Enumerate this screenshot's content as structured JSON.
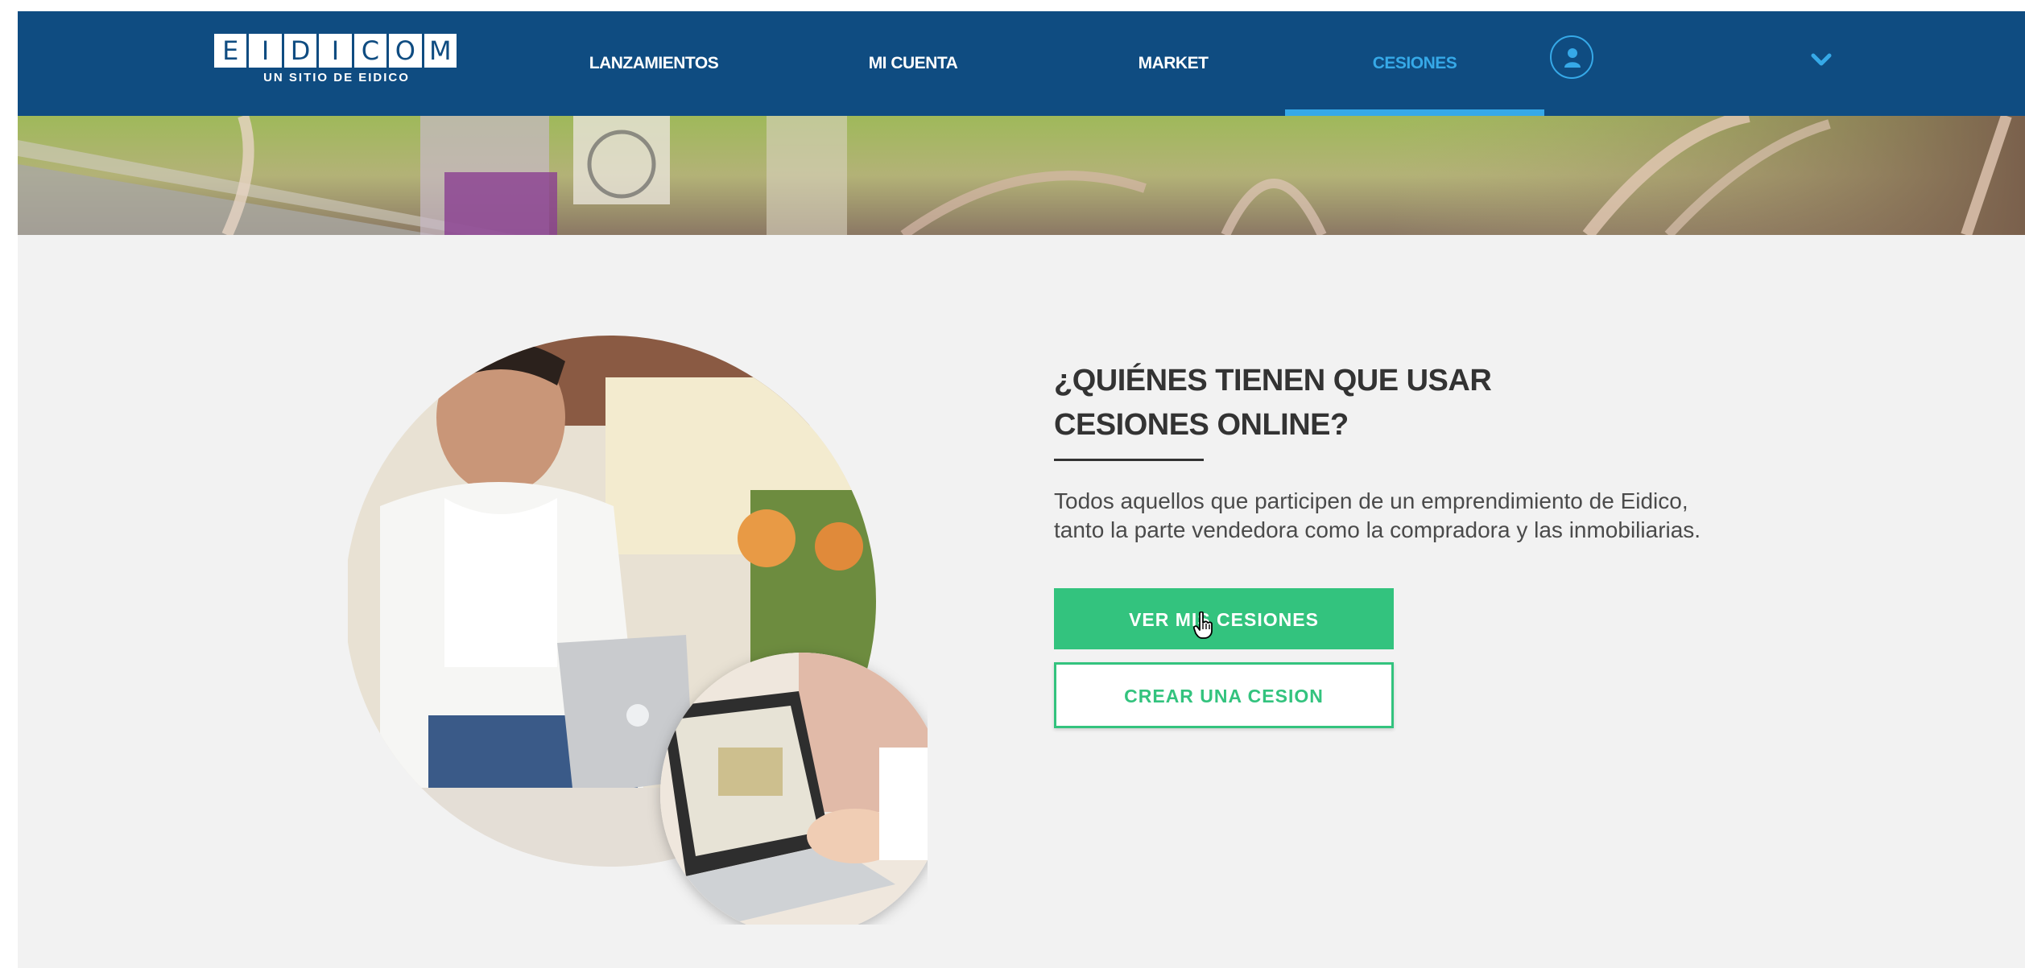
{
  "brand": {
    "logo_letters": [
      "E",
      "I",
      "D",
      "I",
      "C",
      "O",
      "M"
    ],
    "tagline": "UN SITIO DE EIDICO"
  },
  "nav": {
    "items": [
      {
        "label": "LANZAMIENTOS",
        "active": false
      },
      {
        "label": "MI CUENTA",
        "active": false
      },
      {
        "label": "MARKET",
        "active": false
      },
      {
        "label": "CESIONES",
        "active": true
      }
    ]
  },
  "content": {
    "heading_line1": "¿QUIÉNES TIENEN QUE USAR",
    "heading_line2": "CESIONES ONLINE?",
    "description_line1": "Todos aquellos que participen de un emprendimiento de Eidico,",
    "description_line2": "tanto la parte vendedora como la compradora y las inmobiliarias.",
    "primary_button": "VER MIS CESIONES",
    "secondary_button": "CREAR UNA CESION"
  },
  "colors": {
    "nav_bg": "#0f4c81",
    "accent_blue": "#36a9e8",
    "accent_green": "#33c37e",
    "page_bg": "#f2f2f2"
  },
  "icons": {
    "user": "user-icon",
    "dropdown": "chevron-down-icon",
    "cursor": "hand-pointer-icon"
  }
}
